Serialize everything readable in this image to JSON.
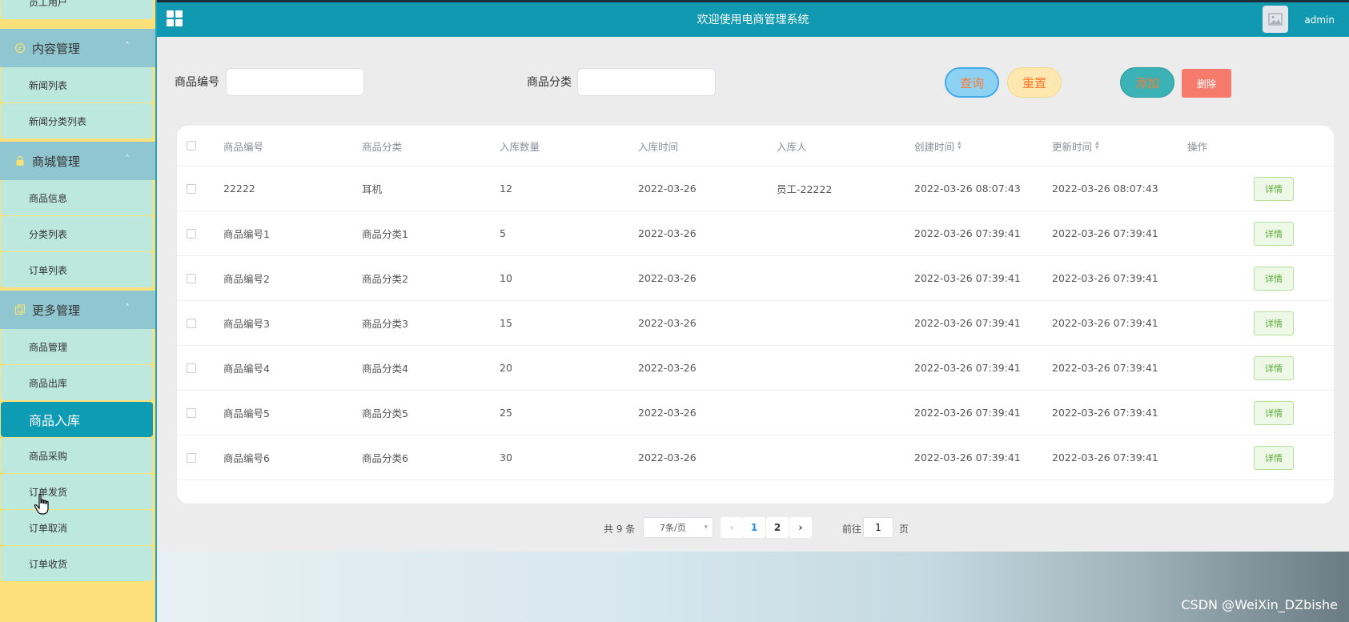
{
  "app": {
    "title": "欢迎使用电商管理系统",
    "user": "admin"
  },
  "sidebar": {
    "items": [
      {
        "label": "员工用户",
        "type": "item"
      },
      {
        "label": "内容管理",
        "type": "group",
        "icon": "chat-icon",
        "expanded": true
      },
      {
        "label": "新闻列表",
        "type": "item"
      },
      {
        "label": "新闻分类列表",
        "type": "item"
      },
      {
        "label": "商城管理",
        "type": "group",
        "icon": "lock-icon",
        "expanded": true
      },
      {
        "label": "商品信息",
        "type": "item"
      },
      {
        "label": "分类列表",
        "type": "item"
      },
      {
        "label": "订单列表",
        "type": "item"
      },
      {
        "label": "更多管理",
        "type": "group",
        "icon": "copy-icon",
        "expanded": true
      },
      {
        "label": "商品管理",
        "type": "item"
      },
      {
        "label": "商品出库",
        "type": "item"
      },
      {
        "label": "商品入库",
        "type": "item",
        "active": true
      },
      {
        "label": "商品采购",
        "type": "item"
      },
      {
        "label": "订单发货",
        "type": "item"
      },
      {
        "label": "订单取消",
        "type": "item"
      },
      {
        "label": "订单收货",
        "type": "item"
      }
    ]
  },
  "search": {
    "field1_label": "商品编号",
    "field1_value": "",
    "field2_label": "商品分类",
    "field2_value": "",
    "query": "查询",
    "reset": "重置",
    "add": "添加",
    "delete": "删除"
  },
  "table": {
    "columns": [
      "商品编号",
      "商品分类",
      "入库数量",
      "入库时间",
      "入库人",
      "创建时间",
      "更新时间",
      "操作"
    ],
    "rows": [
      [
        "22222",
        "耳机",
        "12",
        "2022-03-26",
        "员工-22222",
        "2022-03-26 08:07:43",
        "2022-03-26 08:07:43"
      ],
      [
        "商品编号1",
        "商品分类1",
        "5",
        "2022-03-26",
        "",
        "2022-03-26 07:39:41",
        "2022-03-26 07:39:41"
      ],
      [
        "商品编号2",
        "商品分类2",
        "10",
        "2022-03-26",
        "",
        "2022-03-26 07:39:41",
        "2022-03-26 07:39:41"
      ],
      [
        "商品编号3",
        "商品分类3",
        "15",
        "2022-03-26",
        "",
        "2022-03-26 07:39:41",
        "2022-03-26 07:39:41"
      ],
      [
        "商品编号4",
        "商品分类4",
        "20",
        "2022-03-26",
        "",
        "2022-03-26 07:39:41",
        "2022-03-26 07:39:41"
      ],
      [
        "商品编号5",
        "商品分类5",
        "25",
        "2022-03-26",
        "",
        "2022-03-26 07:39:41",
        "2022-03-26 07:39:41"
      ],
      [
        "商品编号6",
        "商品分类6",
        "30",
        "2022-03-26",
        "",
        "2022-03-26 07:39:41",
        "2022-03-26 07:39:41"
      ]
    ],
    "detail_label": "详情"
  },
  "pagination": {
    "total": "共 9 条",
    "page_size": "7条/页",
    "pages": [
      "1",
      "2"
    ],
    "current_page": "1",
    "goto_label": "前往",
    "goto_value": "1",
    "page_suffix": "页"
  },
  "watermark": "CSDN @WeiXin_DZbishe",
  "colors": {
    "topbar": "#1099b1",
    "sidebar_bg": "#fce07a",
    "sidebar_item": "#bde8dd",
    "sidebar_group": "#8fc6cf",
    "active_item": "#0e9cb5",
    "accent_orange": "#ff7a2f"
  }
}
